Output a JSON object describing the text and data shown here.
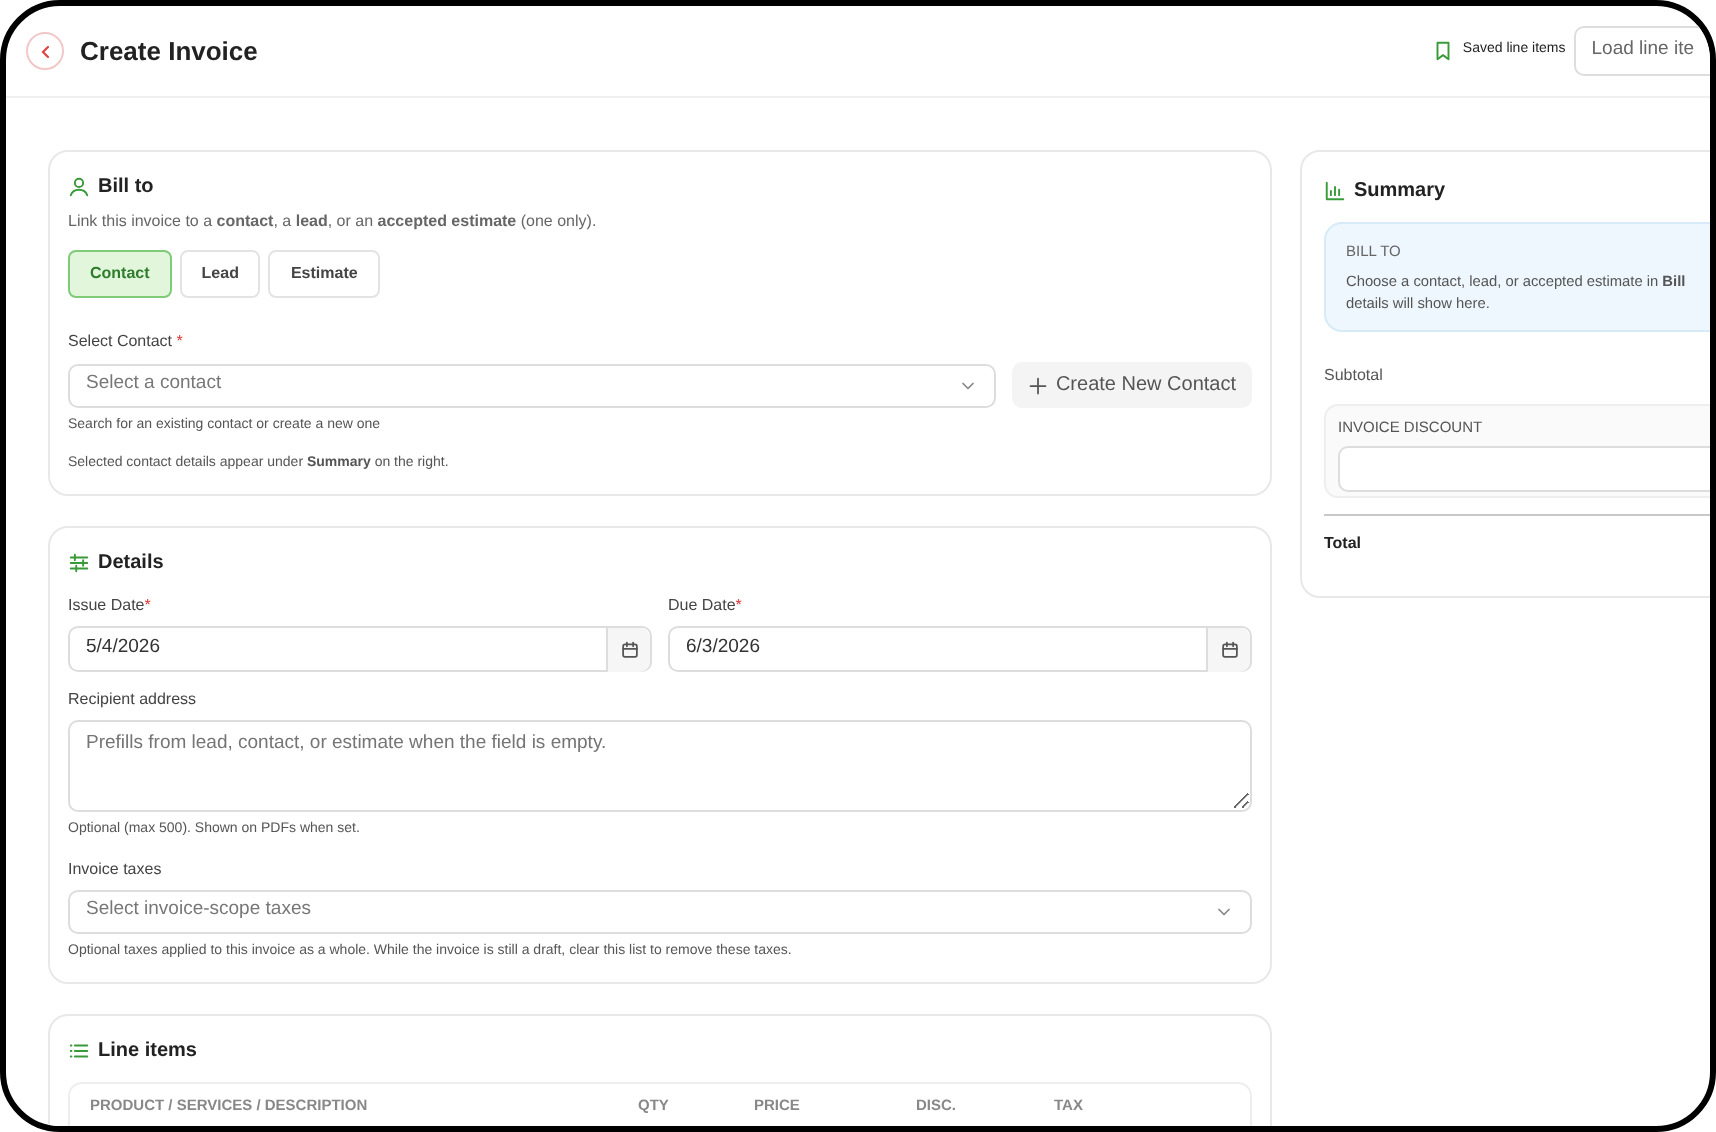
{
  "header": {
    "title": "Create Invoice",
    "saved_label": "Saved line items",
    "load_button": "Load line ite"
  },
  "bill_to": {
    "title": "Bill to",
    "description": "Link this invoice to a **contact**, a **lead**, or an **accepted estimate** (one only).",
    "options": [
      {
        "label": "Contact",
        "selected": true
      },
      {
        "label": "Lead",
        "selected": false
      },
      {
        "label": "Estimate",
        "selected": false
      }
    ],
    "select_label": "Select Contact",
    "required_mark": "*",
    "select_placeholder": "Select a contact",
    "create_button": "Create New Contact",
    "helpers": [
      "Search for an existing contact or create a new one",
      "Selected contact details appear under **Summary** on the right."
    ]
  },
  "details": {
    "title": "Details",
    "dates": [
      {
        "label": "Issue Date",
        "required_mark": "*",
        "value": "5/4/2026"
      },
      {
        "label": "Due Date",
        "required_mark": "*",
        "value": "6/3/2026"
      }
    ],
    "recipient": {
      "label": "Recipient address",
      "placeholder": "Prefills from lead, contact, or estimate when the field is empty.",
      "helper": "Optional (max 500). Shown on PDFs when set."
    },
    "taxes": {
      "label": "Invoice taxes",
      "placeholder": "Select invoice-scope taxes",
      "helper": "Optional taxes applied to this invoice as a whole. While the invoice is still a draft, clear this list to remove these taxes."
    }
  },
  "line_items": {
    "title": "Line items",
    "columns": [
      "PRODUCT / SERVICES / DESCRIPTION",
      "QTY",
      "PRICE",
      "DISC.",
      "TAX"
    ]
  },
  "summary": {
    "title": "Summary",
    "bill_to_label": "BILL TO",
    "bill_to_lines": [
      "Choose a contact, lead, or accepted estimate in **Bill**",
      "details will show here."
    ],
    "subtotal_label": "Subtotal",
    "discount_label": "INVOICE DISCOUNT",
    "total_label": "Total"
  }
}
